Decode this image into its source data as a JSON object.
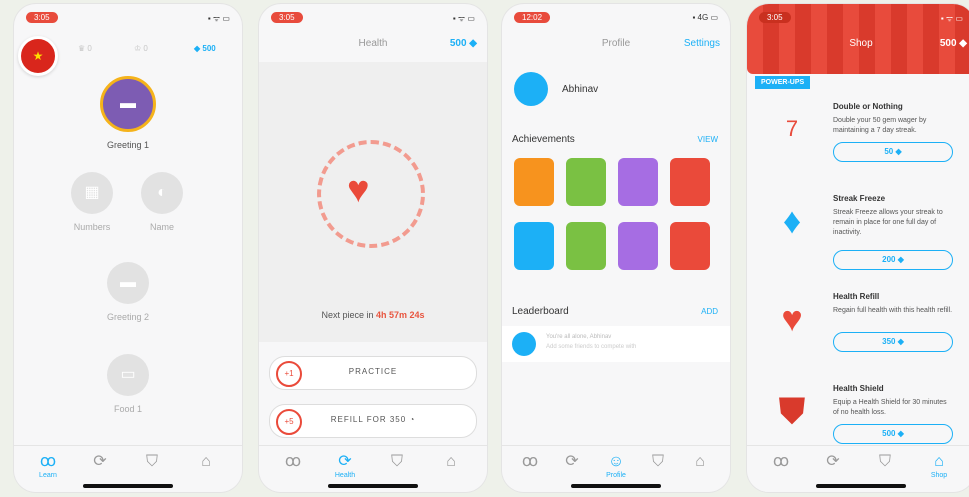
{
  "learn": {
    "time": "3:05",
    "crowns": "0",
    "streak": "0",
    "gems": "500",
    "skills": [
      "Greeting 1",
      "Numbers",
      "Name",
      "Greeting 2",
      "Food 1"
    ],
    "tabs": [
      "Learn"
    ]
  },
  "health": {
    "time": "3:05",
    "title": "Health",
    "gems": "500",
    "next_label": "Next piece in",
    "next_time": "4h 57m 24s",
    "practice_badge": "+1",
    "practice_label": "PRACTICE",
    "refill_badge": "+5",
    "refill_label": "REFILL FOR 350",
    "tabs": [
      "Health"
    ]
  },
  "profile": {
    "time": "12:02",
    "title": "Profile",
    "settings": "Settings",
    "username": "Abhinav",
    "achievements_heading": "Achievements",
    "view": "VIEW",
    "leaderboard_heading": "Leaderboard",
    "add": "ADD",
    "lb_line1": "You're all alone, Abhinav",
    "lb_line2": "Add some friends to compete with",
    "tabs": [
      "Profile"
    ],
    "achievement_colors": [
      "#f7931e",
      "#7ac143",
      "#a66de3",
      "#ea4a3a",
      "#1cb0f6",
      "#7ac143",
      "#a66de3",
      "#ea4a3a"
    ]
  },
  "shop": {
    "time": "3:05",
    "title": "Shop",
    "gems": "500",
    "section": "POWER-UPS",
    "items": [
      {
        "title": "Double or Nothing",
        "desc": "Double your 50 gem wager by maintaining a 7 day streak.",
        "price": "50",
        "calendar_day": "7"
      },
      {
        "title": "Streak Freeze",
        "desc": "Streak Freeze allows your streak to remain in place for one full day of inactivity.",
        "price": "200"
      },
      {
        "title": "Health Refill",
        "desc": "Regain full health with this health refill.",
        "price": "350"
      },
      {
        "title": "Health Shield",
        "desc": "Equip a Health Shield for 30 minutes of no health loss.",
        "price": "500"
      }
    ],
    "tabs": [
      "Shop"
    ]
  }
}
